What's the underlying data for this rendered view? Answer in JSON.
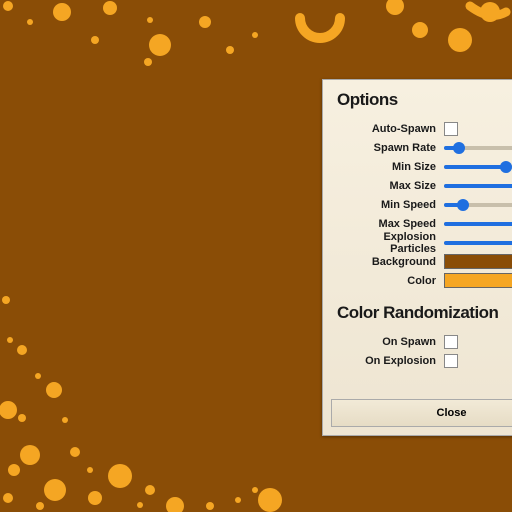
{
  "colors": {
    "background": "#8a4d06",
    "particle": "#f5a623"
  },
  "panel": {
    "title": "Options",
    "rows": {
      "autoSpawn": {
        "label": "Auto-Spawn",
        "checked": false
      },
      "spawnRate": {
        "label": "Spawn Rate",
        "value": 0.12
      },
      "minSize": {
        "label": "Min Size",
        "value": 0.5
      },
      "maxSize": {
        "label": "Max Size",
        "value": 1.0
      },
      "minSpeed": {
        "label": "Min Speed",
        "value": 0.15
      },
      "maxSpeed": {
        "label": "Max Speed",
        "value": 1.0
      },
      "explosionParticles": {
        "label": "Explosion Particles",
        "value": 0.62
      },
      "backgroundSwatch": {
        "label": "Background",
        "color": "#8a4d06"
      },
      "colorSwatch": {
        "label": "Color",
        "color": "#f5a623"
      }
    },
    "section2": {
      "title": "Color Randomization",
      "onSpawn": {
        "label": "On Spawn",
        "checked": false
      },
      "onExplosion": {
        "label": "On Explosion",
        "checked": false
      }
    },
    "closeLabel": "Close"
  }
}
